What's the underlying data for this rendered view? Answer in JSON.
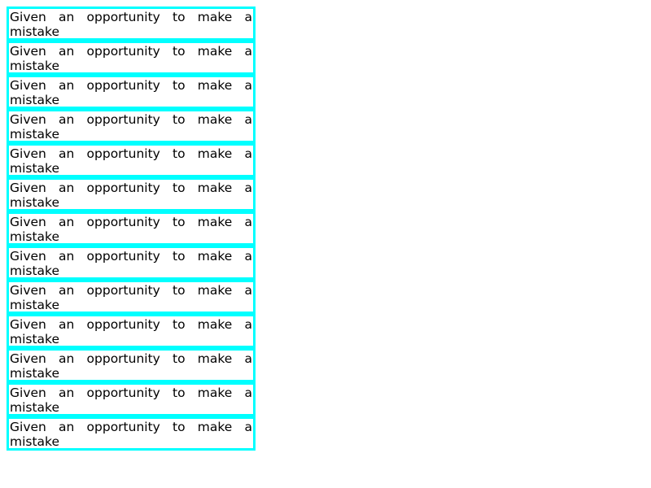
{
  "colors": {
    "border": "#00ffff",
    "text": "#000000",
    "background": "#ffffff"
  },
  "boxes": [
    {
      "text": "Given an opportunity to make a mistake"
    },
    {
      "text": "Given an opportunity to make a mistake"
    },
    {
      "text": "Given an opportunity to make a mistake"
    },
    {
      "text": "Given an opportunity to make a mistake"
    },
    {
      "text": "Given an opportunity to make a mistake"
    },
    {
      "text": "Given an opportunity to make a mistake"
    },
    {
      "text": "Given an opportunity to make a mistake"
    },
    {
      "text": "Given an opportunity to make a mistake"
    },
    {
      "text": "Given an opportunity to make a mistake"
    },
    {
      "text": "Given an opportunity to make a mistake"
    },
    {
      "text": "Given an opportunity to make a mistake"
    },
    {
      "text": "Given an opportunity to make a mistake"
    },
    {
      "text": "Given an opportunity to make a mistake"
    }
  ]
}
